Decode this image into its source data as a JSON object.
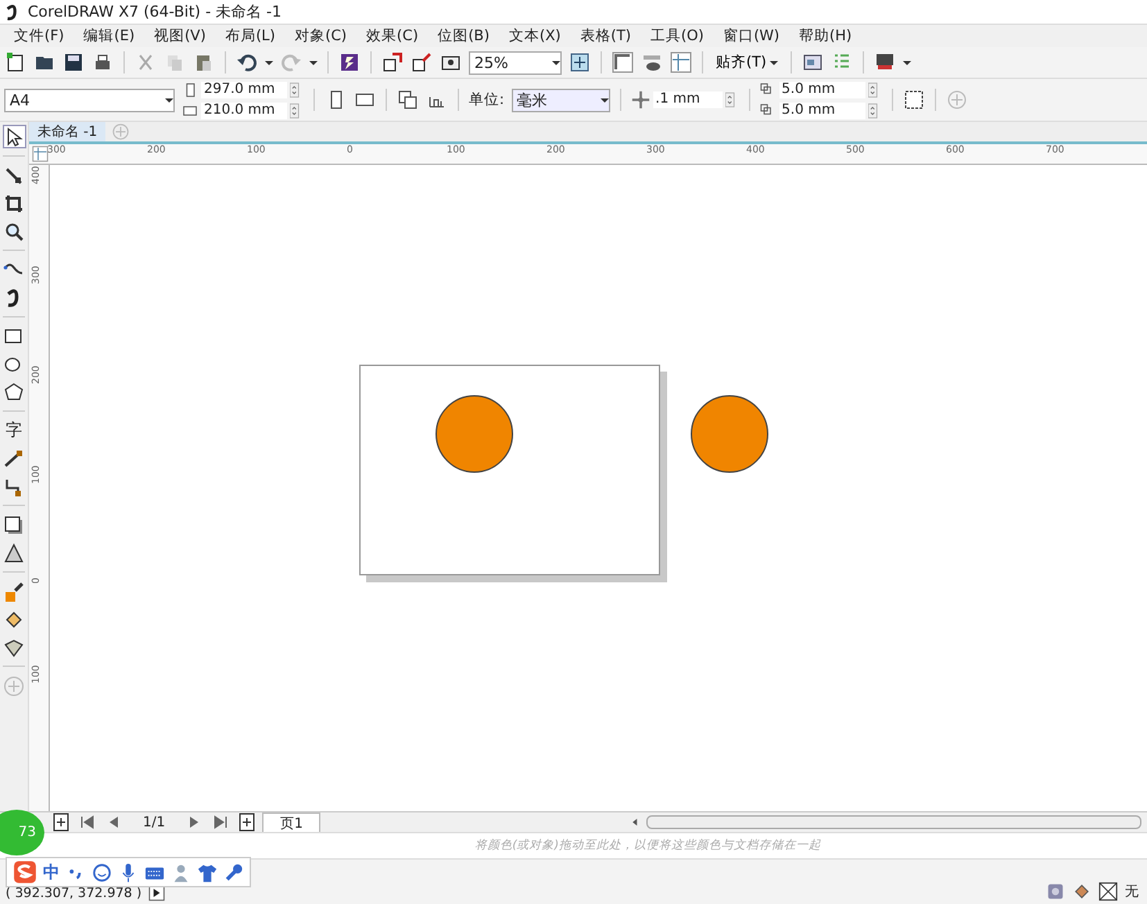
{
  "window": {
    "title": "CorelDRAW X7 (64-Bit) - 未命名 -1"
  },
  "menu": [
    "文件(F)",
    "编辑(E)",
    "视图(V)",
    "布局(L)",
    "对象(C)",
    "效果(C)",
    "位图(B)",
    "文本(X)",
    "表格(T)",
    "工具(O)",
    "窗口(W)",
    "帮助(H)"
  ],
  "standard_toolbar": {
    "zoom": "25%",
    "snap": "贴齐(T)"
  },
  "property_bar": {
    "page_size": "A4",
    "width": "297.0 mm",
    "height": "210.0 mm",
    "units_label": "单位:",
    "units": "毫米",
    "nudge": ".1 mm",
    "dup_x": "5.0 mm",
    "dup_y": "5.0 mm"
  },
  "tabs": [
    {
      "label": "未命名 -1",
      "selected": true
    }
  ],
  "tools": [
    {
      "kind": "pick",
      "selected": true
    },
    {
      "kind": "shape",
      "selected": false
    },
    {
      "kind": "crop",
      "selected": false
    },
    {
      "kind": "zoom",
      "selected": false
    },
    {
      "kind": "freehand",
      "selected": false
    },
    {
      "kind": "artistic",
      "selected": false
    },
    {
      "kind": "rectangle",
      "selected": false
    },
    {
      "kind": "ellipse",
      "selected": false
    },
    {
      "kind": "polygon",
      "selected": false
    },
    {
      "kind": "text",
      "glyph": "字",
      "selected": false
    },
    {
      "kind": "dimension",
      "selected": false
    },
    {
      "kind": "connector",
      "selected": false
    },
    {
      "kind": "shadow",
      "selected": false
    },
    {
      "kind": "transparency",
      "selected": false
    },
    {
      "kind": "eyedropper",
      "selected": false
    },
    {
      "kind": "fill",
      "selected": false
    },
    {
      "kind": "outline",
      "selected": false
    },
    {
      "kind": "add",
      "selected": false
    }
  ],
  "ruler": {
    "horizontal": [
      "300",
      "200",
      "100",
      "0",
      "100",
      "200",
      "300",
      "400",
      "500",
      "600",
      "700"
    ],
    "vertical": [
      "400",
      "300",
      "200",
      "100",
      "0",
      "100"
    ]
  },
  "canvas": {
    "page": {
      "shapes": [
        {
          "kind": "circle",
          "color": "#f08500"
        }
      ]
    },
    "shapes": [
      {
        "kind": "circle",
        "color": "#f08500"
      }
    ]
  },
  "page_nav": {
    "count": "1/1",
    "page_tab": "页1"
  },
  "palette_hint": "将颜色(或对象)拖动至此处，以便将这些颜色与文档存储在一起",
  "status_bar": {
    "coordinates": "( 392.307, 372.978 )",
    "fill": "无"
  },
  "ime_bar": {
    "mode": "中"
  },
  "badge": "73"
}
